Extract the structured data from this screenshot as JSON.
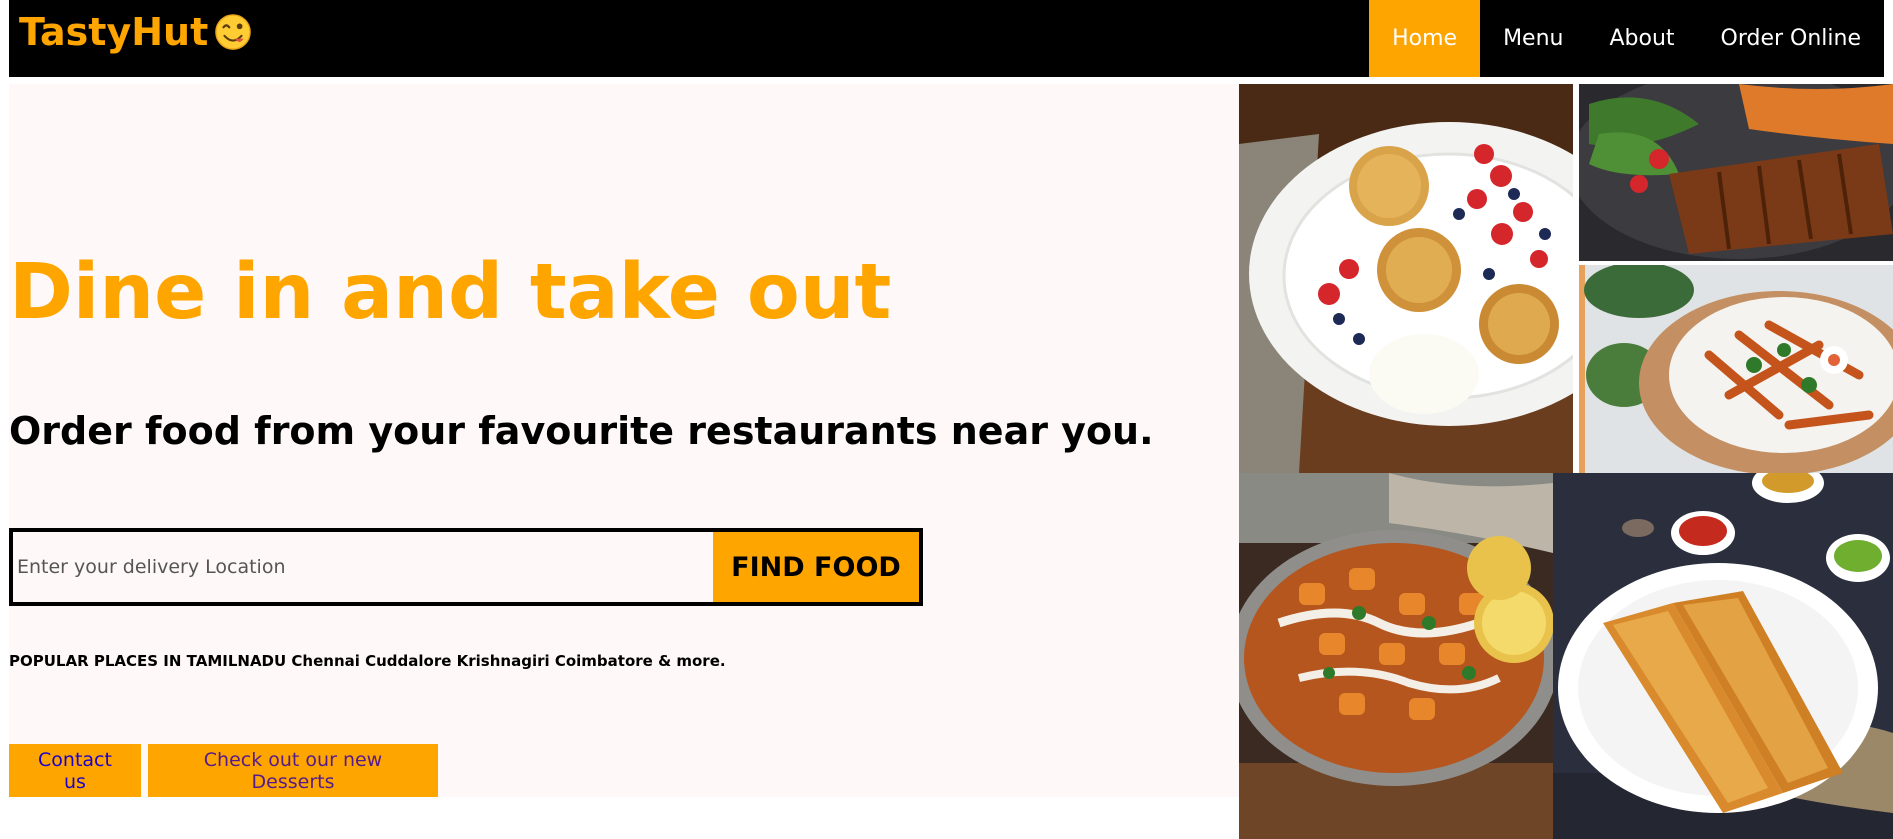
{
  "nav": {
    "brand": "TastyHut",
    "brand_icon": "face-savoring-food-icon",
    "links": [
      {
        "label": "Home",
        "active": true
      },
      {
        "label": "Menu",
        "active": false
      },
      {
        "label": "About",
        "active": false
      },
      {
        "label": "Order Online",
        "active": false
      }
    ]
  },
  "hero": {
    "title": "Dine in and take out",
    "subtitle": "Order food from your favourite restaurants near you.",
    "search_placeholder": "Enter your delivery Location",
    "search_button": "FIND FOOD",
    "popular": "POPULAR PLACES IN TAMILNADU Chennai Cuddalore Krishnagiri Coimbatore & more."
  },
  "buttons": {
    "contact": "Contact us",
    "desserts": "Check out our new Desserts"
  },
  "colors": {
    "accent": "#FFA500",
    "nav_bg": "#000000",
    "hero_bg": "#FFF8F8"
  },
  "gallery": {
    "photos": [
      "pancakes-with-berries-photo",
      "grilled-chicken-salad-photo",
      "sweet-potato-fries-bowl-photo",
      "paneer-curry-photo",
      "masala-dosa-photo"
    ]
  }
}
